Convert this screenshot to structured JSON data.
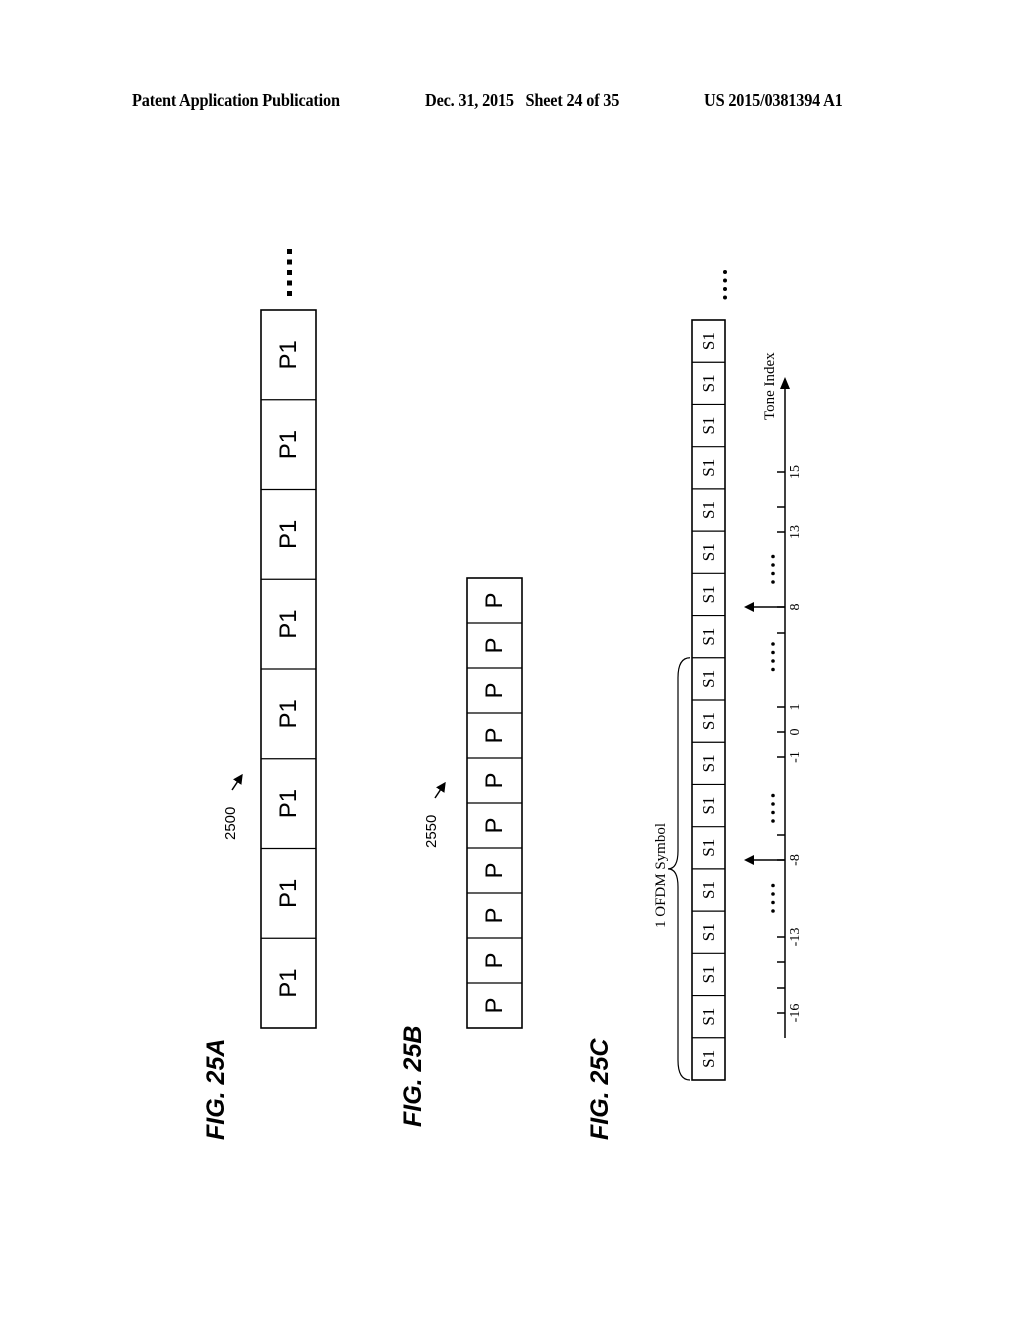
{
  "header": {
    "left": "Patent Application Publication",
    "date_sheet": "Dec. 31, 2015   Sheet 24 of 35",
    "pub_number": "US 2015/0381394 A1"
  },
  "figures": [
    {
      "id": "fig25a",
      "label": "FIG. 25A",
      "ref": "2500",
      "cells": [
        "P1",
        "P1",
        "P1",
        "P1",
        "P1",
        "P1",
        "P1",
        "P1"
      ],
      "continuation": "....."
    },
    {
      "id": "fig25b",
      "label": "FIG. 25B",
      "ref": "2550",
      "cells": [
        "P",
        "P",
        "P",
        "P",
        "P",
        "P",
        "P",
        "P",
        "P",
        "P"
      ]
    },
    {
      "id": "fig25c",
      "label": "FIG. 25C",
      "cells": [
        "S1",
        "S1",
        "S1",
        "S1",
        "S1",
        "S1",
        "S1",
        "S1",
        "S1",
        "S1",
        "S1",
        "S1",
        "S1",
        "S1",
        "S1",
        "S1",
        "S1",
        "S1"
      ],
      "continuation": "....",
      "brace_label": "1 OFDM Symbol",
      "brace_span_cells": 10,
      "axis": {
        "label": "Tone Index",
        "ticks": [
          {
            "value": -16,
            "label": "-16"
          },
          {
            "value": -15,
            "label": ""
          },
          {
            "value": -14,
            "label": ""
          },
          {
            "value": -13,
            "label": "-13"
          },
          {
            "value": -9,
            "label": ""
          },
          {
            "value": -8,
            "label": "-8"
          },
          {
            "value": -1,
            "label": "-1"
          },
          {
            "value": 0,
            "label": "0"
          },
          {
            "value": 1,
            "label": "1"
          },
          {
            "value": 7,
            "label": ""
          },
          {
            "value": 8,
            "label": "8"
          },
          {
            "value": 13,
            "label": "13"
          },
          {
            "value": 14,
            "label": ""
          },
          {
            "value": 15,
            "label": "15"
          }
        ],
        "pilot_tones": [
          -8,
          8
        ],
        "ellipsis": "....",
        "ellipsis_between": [
          [
            -13,
            -8
          ],
          [
            -8,
            -1
          ],
          [
            1,
            8
          ],
          [
            8,
            13
          ]
        ]
      }
    }
  ]
}
